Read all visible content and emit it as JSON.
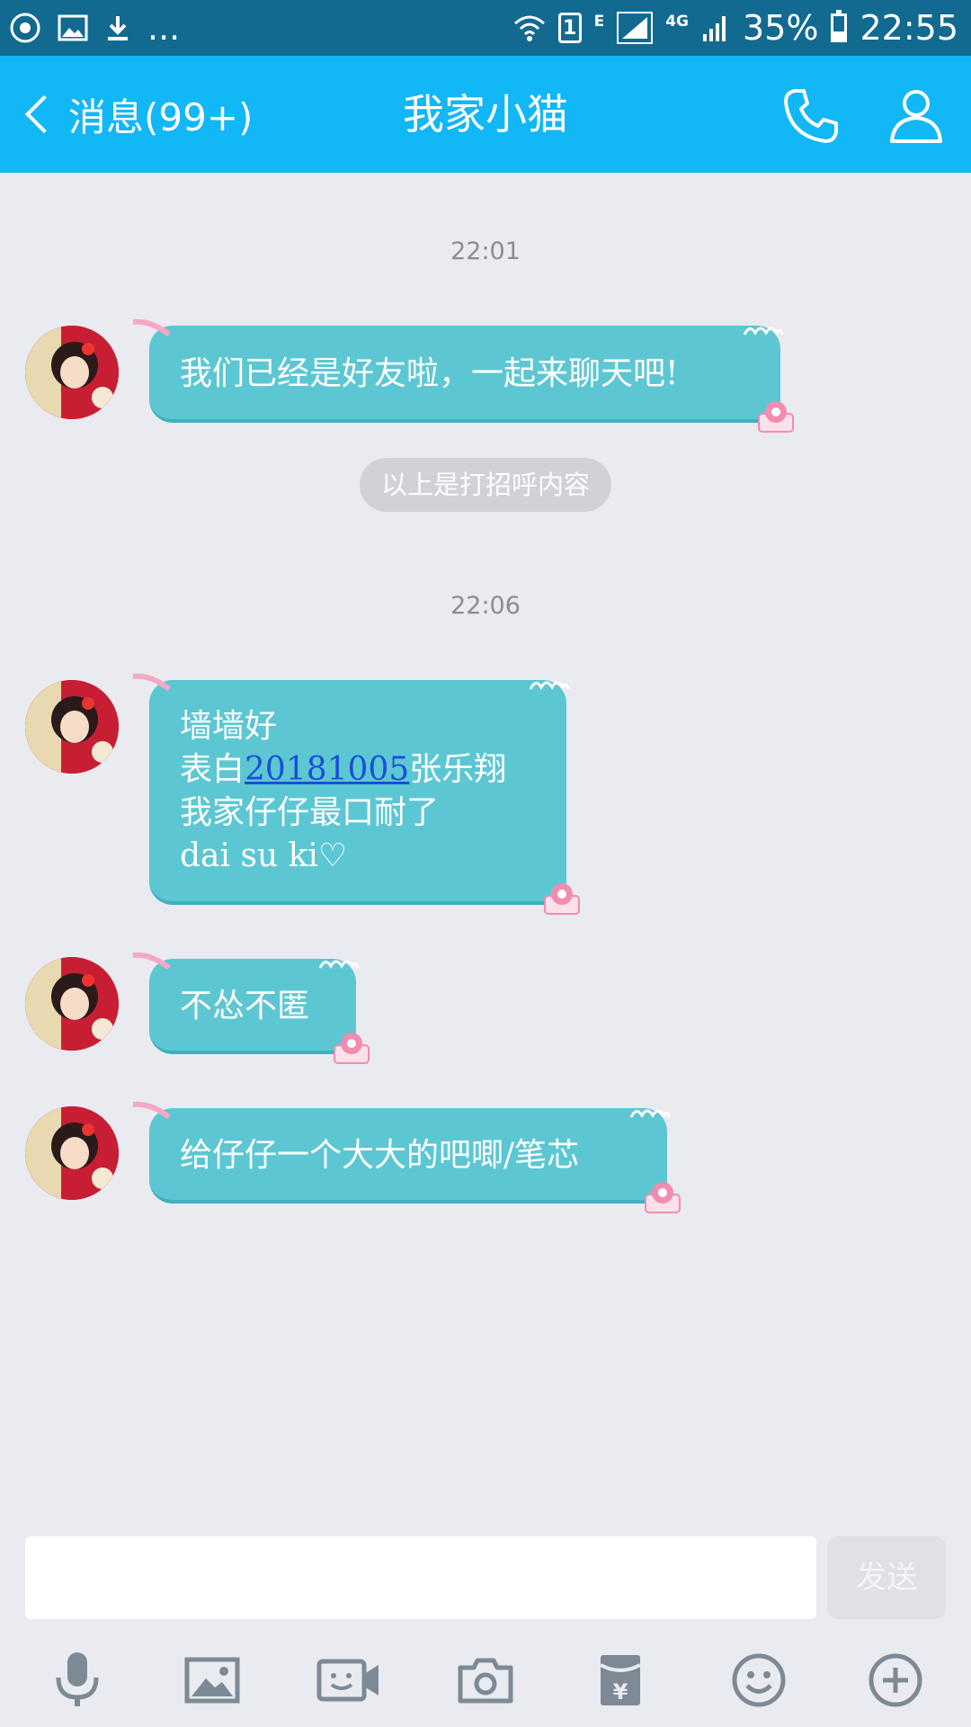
{
  "status_bar": {
    "network_type": "E",
    "network_gen": "4G",
    "sim_label": "1",
    "battery_percent": "35%",
    "battery_level": 0.35,
    "time": "22:55",
    "overflow": "..."
  },
  "header": {
    "back_label": "消息(99+)",
    "title": "我家小猫",
    "call_icon": "phone-icon",
    "profile_icon": "person-icon",
    "color": "#12b7f5"
  },
  "chat": {
    "timestamp_1": "22:01",
    "timestamp_2": "22:06",
    "system_notice": "以上是打招呼内容",
    "messages": [
      {
        "text": "我们已经是好友啦，一起来聊天吧!"
      },
      {
        "line1": "墙墙好",
        "line2_prefix": "表白",
        "line2_link": "20181005",
        "line2_suffix": "张乐翔",
        "line3": "我家仔仔最口耐了",
        "line4": "dai su ki♡"
      },
      {
        "text": "不怂不匿"
      },
      {
        "text": "给仔仔一个大大的吧唧/笔芯"
      }
    ],
    "bubble_color": "#5cc7d3"
  },
  "input": {
    "value": "",
    "send_label": "发送"
  },
  "toolbar": {
    "items": [
      "microphone-icon",
      "image-icon",
      "video-call-icon",
      "camera-icon",
      "red-packet-icon",
      "emoji-icon",
      "plus-icon"
    ]
  }
}
